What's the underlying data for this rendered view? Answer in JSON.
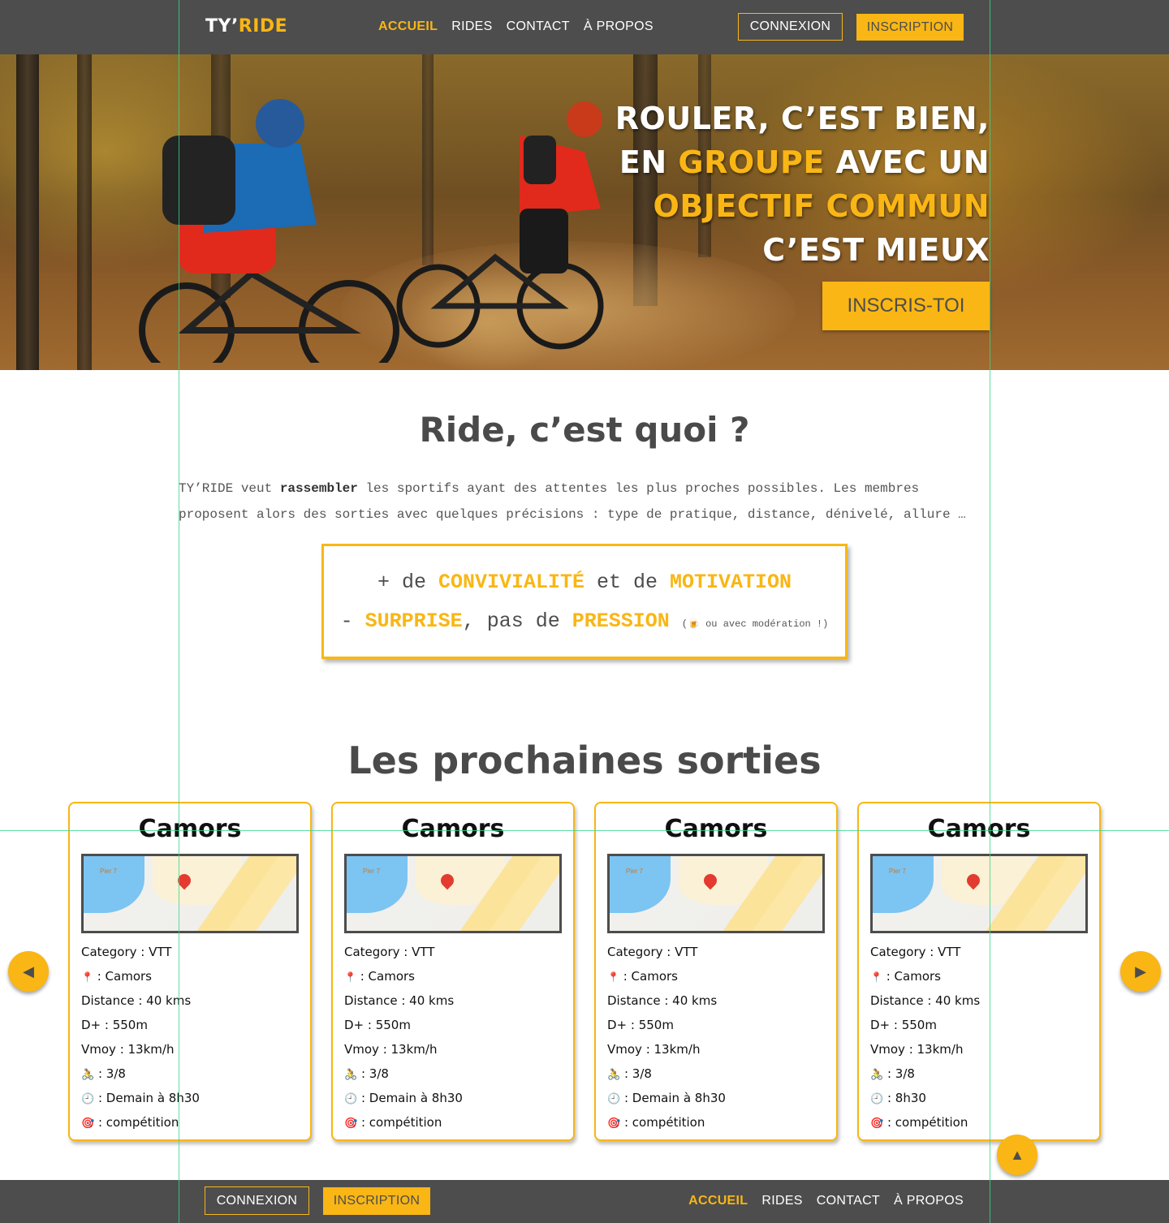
{
  "header": {
    "logo_main": "TY’",
    "logo_accent": "RIDE",
    "nav": [
      "ACCUEIL",
      "RIDES",
      "CONTACT",
      "À PROPOS"
    ],
    "login_label": "CONNEXION",
    "signup_label": "INSCRIPTION"
  },
  "hero": {
    "line1": "ROULER, C’EST BIEN,",
    "line2_a": "EN ",
    "line2_b": "GROUPE",
    "line2_c": " AVEC UN",
    "line3": "OBJECTIF COMMUN",
    "line4": "C’EST MIEUX",
    "cta_label": "INSCRIS-TOI"
  },
  "intro": {
    "title": "Ride, c’est quoi ?",
    "text_a": "TY’RIDE veut ",
    "text_b": "rassembler",
    "text_c": " les sportifs ayant des attentes les plus proches possibles. Les membres proposent alors des sorties avec quelques précisions : type de pratique, distance, dénivelé, allure …",
    "box_line1_a": "+ de ",
    "box_line1_b": "CONVIVIALITÉ",
    "box_line1_c": " et de ",
    "box_line1_d": "MOTIVATION",
    "box_line2_a": "- ",
    "box_line2_b": "SURPRISE",
    "box_line2_c": ", pas de ",
    "box_line2_d": "PRESSION",
    "box_line2_e": "(🍺 ou avec modération !)"
  },
  "rides": {
    "title": "Les prochaines sorties",
    "map_label": "Pier 7",
    "cards": [
      {
        "title": "Camors",
        "category": "Category : VTT",
        "place": ": Camors",
        "distance": "Distance : 40 kms",
        "dplus": "D+ : 550m",
        "vmoy": "Vmoy : 13km/h",
        "riders": ": 3/8",
        "time": ":  Demain à 8h30",
        "goal": ": compétition"
      },
      {
        "title": "Camors",
        "category": "Category : VTT",
        "place": ": Camors",
        "distance": "Distance : 40 kms",
        "dplus": "D+ : 550m",
        "vmoy": "Vmoy : 13km/h",
        "riders": ": 3/8",
        "time": ":  Demain à 8h30",
        "goal": ": compétition"
      },
      {
        "title": "Camors",
        "category": "Category : VTT",
        "place": ": Camors",
        "distance": "Distance : 40 kms",
        "dplus": "D+ : 550m",
        "vmoy": "Vmoy : 13km/h",
        "riders": ": 3/8",
        "time": ":  Demain à 8h30",
        "goal": ": compétition"
      },
      {
        "title": "Camors",
        "category": "Category : VTT",
        "place": ": Camors",
        "distance": "Distance : 40 kms",
        "dplus": "D+ : 550m",
        "vmoy": "Vmoy : 13km/h",
        "riders": ": 3/8",
        "time": ": 8h30",
        "goal": ": compétition"
      }
    ]
  },
  "icons": {
    "pin": "📍",
    "bike": "🚴",
    "clock": "🕘",
    "target": "🎯",
    "prev": "◀",
    "next": "▶",
    "top": "▲"
  },
  "footer": {
    "login_label": "CONNEXION",
    "signup_label": "INSCRIPTION",
    "nav": [
      "ACCUEIL",
      "RIDES",
      "CONTACT",
      "À PROPOS"
    ]
  },
  "colors": {
    "accent": "#f9b614",
    "header_bg": "#4d4d4d"
  }
}
